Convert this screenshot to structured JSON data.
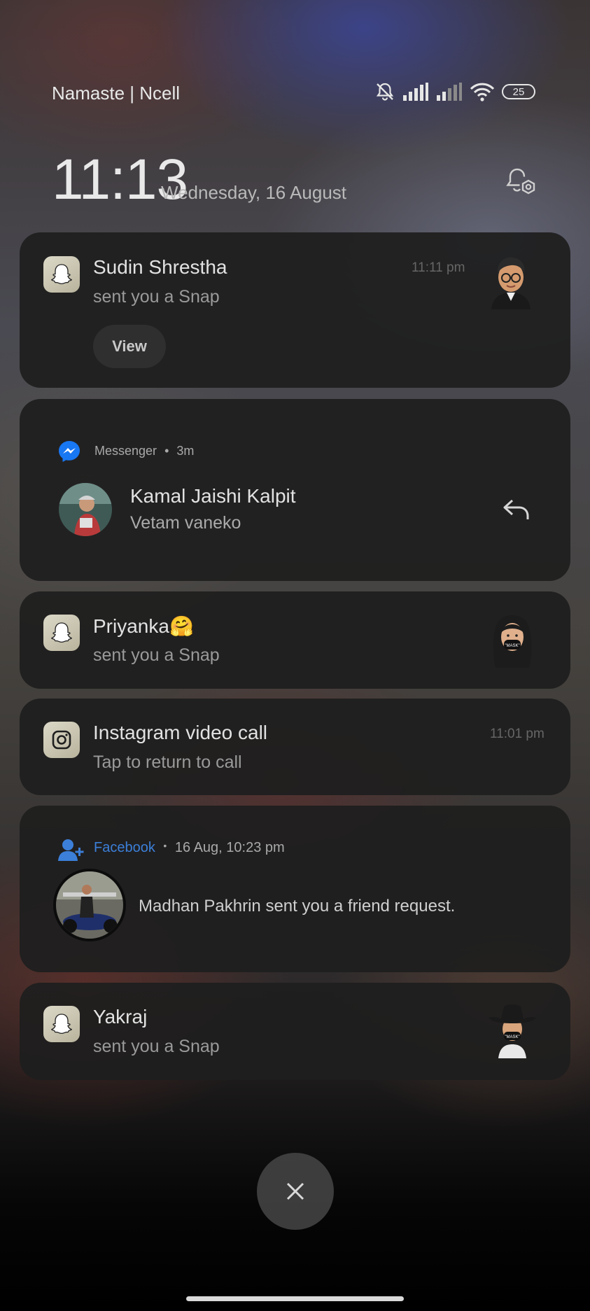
{
  "status_bar": {
    "carrier": "Namaste | Ncell",
    "battery": "25",
    "icons": [
      "bell-off-icon",
      "signal-icon",
      "signal-icon",
      "wifi-icon",
      "battery-icon"
    ]
  },
  "lock": {
    "time": "11:13",
    "date": "Wednesday, 16 August"
  },
  "notifications": [
    {
      "app": "Snapchat",
      "icon": "snapchat-ghost-icon",
      "title": "Sudin Shrestha",
      "text": "sent you a Snap",
      "time": "11:11 pm",
      "action": "View"
    },
    {
      "app": "Messenger",
      "icon": "messenger-icon",
      "meta_app": "Messenger",
      "meta_time": "3m",
      "title": "Kamal Jaishi Kalpit",
      "text": "Vetam vaneko",
      "action_icon": "reply-icon"
    },
    {
      "app": "Snapchat",
      "icon": "snapchat-ghost-icon",
      "title": "Priyanka🤗",
      "text": "sent you a Snap"
    },
    {
      "app": "Instagram",
      "icon": "instagram-icon",
      "title": "Instagram video call",
      "text": "Tap to return to call",
      "time": "11:01 pm"
    },
    {
      "app": "Facebook",
      "icon": "facebook-friend-icon",
      "meta_app": "Facebook",
      "meta_time": "16 Aug, 10:23 pm",
      "text": "Madhan Pakhrin sent you a friend request."
    },
    {
      "app": "Snapchat",
      "icon": "snapchat-ghost-icon",
      "title": "Yakraj",
      "text": "sent you a Snap"
    }
  ],
  "colors": {
    "accent_facebook": "#3b7fd9",
    "messenger": "#1877f2",
    "card_bg": "#1e1e1e"
  }
}
